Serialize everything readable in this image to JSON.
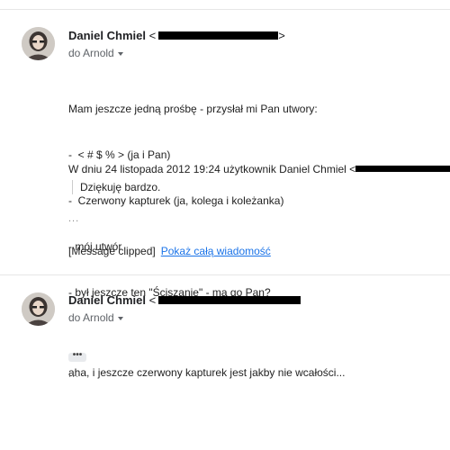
{
  "message1": {
    "sender_name": "Daniel Chmiel",
    "sender_email_open": "<",
    "sender_email_close": ">",
    "to_label": "do Arnold",
    "body_lines": [
      "Mam jeszcze jedną prośbę - przysłał mi Pan utwory:",
      "-  < # $ % > (ja i Pan)",
      "-  Czerwony kapturek (ja, kolega i koleżanka)",
      "- mój utwór",
      "- był jeszcze ten \"Ściszanie\" - ma go Pan?"
    ],
    "quote_header": "W dniu 24 listopada 2012 19:24 użytkownik Daniel Chmiel <",
    "quote_text": "Dziękuję bardzo.",
    "trimmed": "...",
    "clipped_label": "[Message clipped]",
    "show_full_link": "Pokaż całą wiadomość"
  },
  "message2": {
    "sender_name": "Daniel Chmiel",
    "sender_email_open": "<",
    "to_label": "do Arnold",
    "body_text": "aha, i jeszcze czerwony kapturek jest jakby nie wcałości...",
    "more_button": "•••",
    "trimmed": "..."
  },
  "colors": {
    "link": "#1a73e8",
    "redaction": "#000000",
    "divider": "#e6e6e6"
  }
}
